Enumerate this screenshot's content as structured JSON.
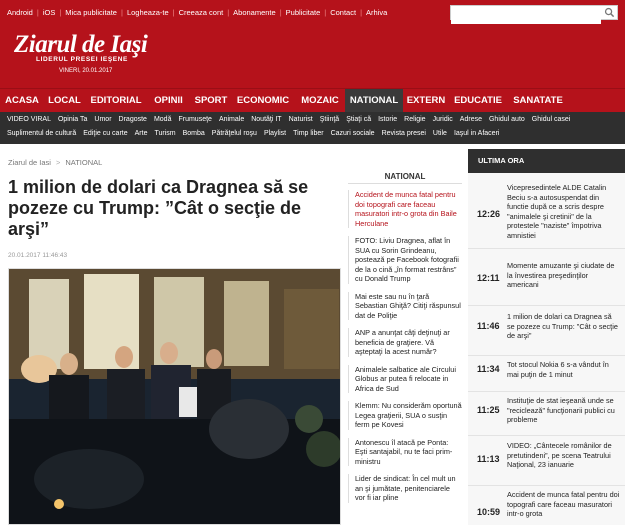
{
  "topbar": {
    "links": [
      "Android",
      "iOS",
      "Mica publicitate",
      "Logheaza-te",
      "Creeaza cont",
      "Abonamente",
      "Publicitate",
      "Contact",
      "Arhiva"
    ],
    "search_placeholder": ""
  },
  "brand": {
    "logo": "Ziarul de Iaşi",
    "tagline": "LIDERUL PRESEI IEŞENE",
    "date": "VINERI, 20.01.2017"
  },
  "colors": {
    "brand_red": "#b5121b",
    "dark_nav": "#2f2f2f",
    "active_tab": "#3a3a3a"
  },
  "main_nav": {
    "items": [
      "ACASA",
      "LOCAL",
      "EDITORIAL",
      "OPINII",
      "SPORT",
      "ECONOMIC",
      "MOZAIC",
      "NATIONAL",
      "EXTERN",
      "EDUCATIE",
      "SANATATE"
    ],
    "active": "NATIONAL"
  },
  "sub_nav": {
    "row1": [
      "VIDEO VIRAL",
      "Opinia Ta",
      "Umor",
      "Dragoste",
      "Modă",
      "Frumuseţe",
      "Animale",
      "Noutăţi IT",
      "Naturist",
      "Ştiinţă",
      "Ştiaţi că",
      "Istorie",
      "Religie",
      "Juridic",
      "Adrese",
      "Ghidul auto",
      "Ghidul casei"
    ],
    "row2": [
      "Suplimentul de cultură",
      "Ediţie cu carte",
      "Arte",
      "Turism",
      "Bomba",
      "Pătrăţelul roşu",
      "Playlist",
      "Timp liber",
      "Cazuri sociale",
      "Revista presei",
      "Utile",
      "Iaşul in Afaceri"
    ]
  },
  "breadcrumb": {
    "home": "Ziarul de Iasi",
    "separator": ">",
    "section": "NATIONAL"
  },
  "article": {
    "title": "1 milion de dolari ca Dragnea să se pozeze cu Trump: ”Cât o secţie de arşi”",
    "datetime": "20.01.2017 11:46:43"
  },
  "national_column": {
    "heading": "NATIONAL",
    "items": [
      {
        "lead": "Accident de munca fatal pentru doi topografi care faceau masuratori intr-o grota din Baile Herculane",
        "rest": ""
      },
      {
        "lead": "",
        "rest": "FOTO: Liviu Dragnea, aflat în SUA cu Sorin Grindeanu, postează pe Facebook fotografii de la o cină „în format restrâns” cu Donald Trump"
      },
      {
        "lead": "",
        "rest": "Mai este sau nu în ţară Sebastian Ghiţă? Citiţi răspunsul dat de Poliţie"
      },
      {
        "lead": "",
        "rest": "ANP a anunţat câţi deţinuţi ar beneficia de graţiere. Vă aşteptaţi la acest număr?"
      },
      {
        "lead": "",
        "rest": "Animalele salbatice ale Circului Globus ar putea fi relocate in Africa de Sud"
      },
      {
        "lead": "",
        "rest": "Klemm: Nu considerăm oportună Legea graţierii, SUA o susţin ferm pe Kovesi"
      },
      {
        "lead": "",
        "rest": "Antonescu îl atacă pe Ponta: Eşti santajabil, nu te faci prim-ministru"
      },
      {
        "lead": "",
        "rest": "Lider de sindicat: În cel mult un an şi jumătate, penitenciarele vor fi iar pline"
      }
    ]
  },
  "latest": {
    "heading": "ULTIMA ORA",
    "items": [
      {
        "time": "12:26",
        "text": "Vicepresedintele ALDE Catalin Beciu s-a autosuspendat din functie după ce a scris despre \"animalele şi cretinii\" de la protestele \"naziste\" împotriva amnistiei"
      },
      {
        "time": "12:11",
        "text": "Momente amuzante şi ciudate de la învestirea preşedinţilor americani"
      },
      {
        "time": "11:46",
        "text": "1 milion de dolari ca Dragnea să se pozeze cu Trump: \"Cât o secţie de arşi\""
      },
      {
        "time": "11:34",
        "text": "Tot stocul Nokia 6 s-a vândut în mai puţin de 1 minut"
      },
      {
        "time": "11:25",
        "text": "Instituţie de stat ieşeană unde se \"reciclează\" funcţionarii publici cu probleme"
      },
      {
        "time": "11:13",
        "text": "VIDEO: „Cântecele românilor de pretutindeni”, pe scena Teatrului Naţional, 23 ianuarie"
      },
      {
        "time": "10:59",
        "text": "Accident de munca fatal pentru doi topografi care faceau masuratori intr-o grota"
      }
    ]
  }
}
